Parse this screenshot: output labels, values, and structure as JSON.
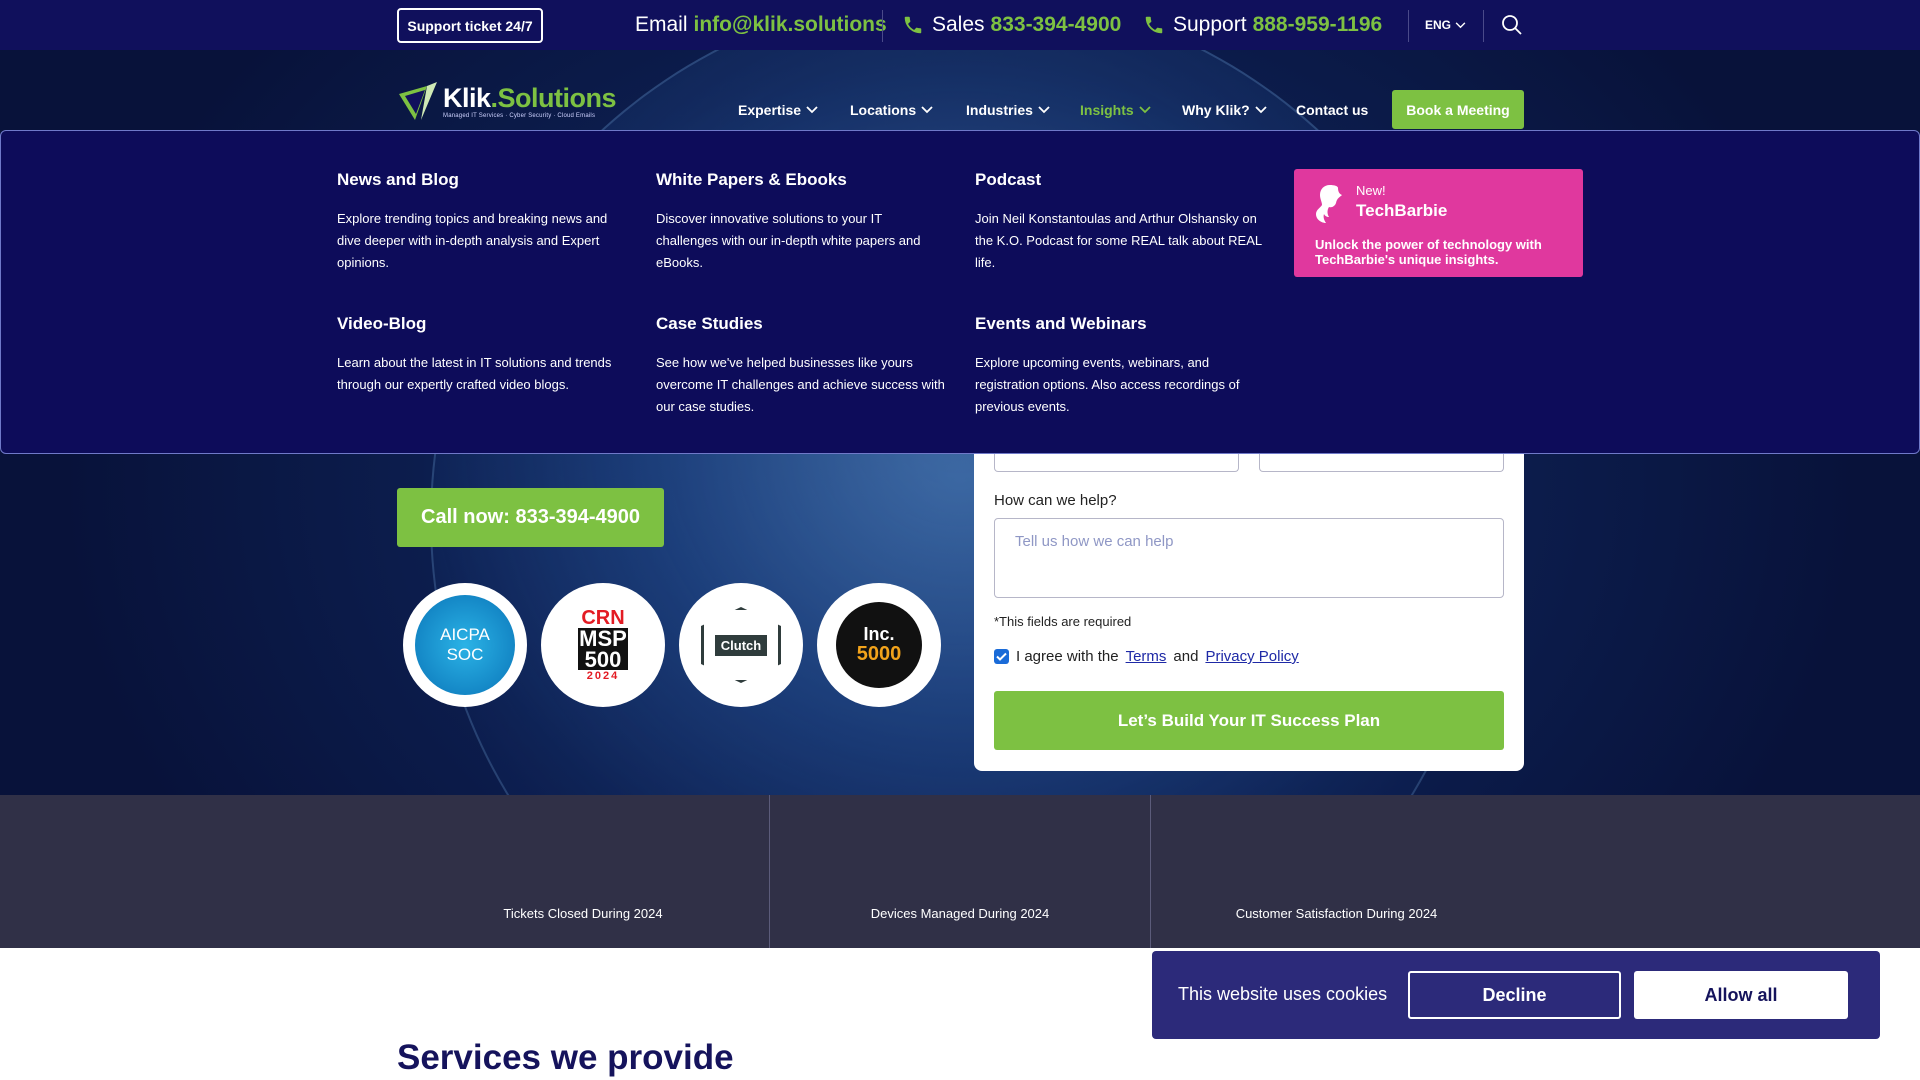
{
  "topbar": {
    "support_ticket": "Support ticket 24/7",
    "email_label": "Email",
    "email_value": "info@klik.solutions",
    "sales_label": "Sales",
    "sales_value": "833-394-4900",
    "support_label": "Support",
    "support_value": "888-959-1196",
    "language": "ENG"
  },
  "logo": {
    "brand_main": "Klik",
    "brand_dot": ".Solutions",
    "tagline": "Managed IT Services · Cyber Security · Cloud Emails"
  },
  "nav": {
    "items": [
      {
        "label": "Expertise"
      },
      {
        "label": "Locations"
      },
      {
        "label": "Industries"
      },
      {
        "label": "Insights"
      },
      {
        "label": "Why Klik?"
      },
      {
        "label": "Contact us"
      }
    ],
    "book_button": "Book a Meeting"
  },
  "mega_menu": {
    "columns": [
      {
        "title": "News and Blog",
        "description": "Explore trending topics and breaking news and dive deeper with in-depth analysis and Expert opinions."
      },
      {
        "title": "White Papers & Ebooks",
        "description": "Discover innovative solutions to your IT challenges with our in-depth white papers and eBooks."
      },
      {
        "title": "Podcast",
        "description": "Join Neil Konstantoulas and Arthur Olshansky on the K.O. Podcast for some REAL talk about REAL life."
      },
      {
        "title": "Video-Blog",
        "description": "Learn about the latest in IT solutions and trends through our expertly crafted video blogs."
      },
      {
        "title": "Case Studies",
        "description": "See how we've helped businesses like yours overcome IT challenges and achieve success with our case studies."
      },
      {
        "title": "Events and Webinars",
        "description": "Explore upcoming events, webinars, and registration options. Also access recordings of previous events."
      }
    ],
    "promo": {
      "new_label": "New!",
      "title": "TechBarbie",
      "description": "Unlock the power of technology with TechBarbie's unique insights."
    }
  },
  "hero": {
    "call_button": "Call now: 833-394-4900",
    "badges": [
      {
        "line1": "AICPA",
        "line2": "SOC"
      },
      {
        "line1": "CRN",
        "line2": "MSP",
        "line3": "500",
        "line4": "2024"
      },
      {
        "line1": "Clutch"
      },
      {
        "line1": "Inc.",
        "line2": "5000"
      }
    ]
  },
  "form": {
    "help_label": "How can we help?",
    "help_placeholder": "Tell us how we can help",
    "required_note": "*This fields are required",
    "agree_prefix": "I agree with the",
    "terms_link": "Terms",
    "agree_and": "and",
    "privacy_link": "Privacy Policy",
    "submit_button": "Let’s Build Your IT Success Plan"
  },
  "stats": [
    {
      "label": "Tickets Closed During 2024"
    },
    {
      "label": "Devices Managed During 2024"
    },
    {
      "label": "Customer Satisfaction During 2024"
    }
  ],
  "services": {
    "title": "Services we provide"
  },
  "cookie": {
    "text": "This website uses cookies",
    "decline": "Decline",
    "allow": "Allow all"
  },
  "colors": {
    "navy": "#10105c",
    "green": "#7dc142",
    "pink": "#e0389e",
    "cookie_bg": "#2c2a7a"
  }
}
